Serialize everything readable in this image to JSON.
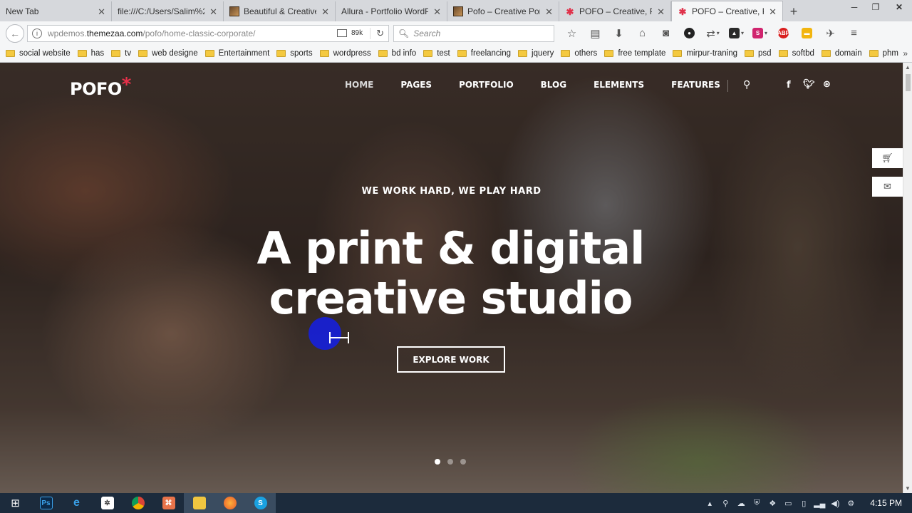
{
  "browser": {
    "tabs": [
      {
        "title": "New Tab",
        "favicon": "none",
        "active": false
      },
      {
        "title": "file:///C:/Users/Salim%2",
        "favicon": "none",
        "active": false
      },
      {
        "title": "Beautiful & Creative",
        "favicon": "theme-thumb-icon",
        "active": false
      },
      {
        "title": "Allura - Portfolio WordP",
        "favicon": "none",
        "active": false
      },
      {
        "title": "Pofo – Creative Port",
        "favicon": "theme-thumb-icon",
        "active": false
      },
      {
        "title": "POFO – Creative, Po",
        "favicon": "pofo-star-icon",
        "active": false
      },
      {
        "title": "POFO – Creative, Po",
        "favicon": "pofo-star-icon",
        "active": true
      }
    ],
    "close_glyph": "✕",
    "new_tab_glyph": "+",
    "window_controls": {
      "minimize": "─",
      "restore": "❐",
      "close": "✕"
    },
    "url": {
      "prefix": "wpdemos.",
      "domain": "themezaa.com",
      "path": "/pofo/home-classic-corporate/"
    },
    "page_size": "89k",
    "search_placeholder": "Search",
    "toolbar_icons": [
      "star-icon",
      "library-icon",
      "download-icon",
      "home-icon",
      "pocket-icon",
      "extension-dark-icon",
      "extension-arrows-icon",
      "extension-hat-icon",
      "extension-s-icon",
      "adblock-icon",
      "extension-yellow-icon",
      "extension-pin-icon",
      "menu-icon"
    ],
    "bookmarks": [
      "social website",
      "has",
      "tv",
      "web designe",
      "Entertainment",
      "sports",
      "wordpress",
      "bd info",
      "test",
      "freelancing",
      "jquery",
      "others",
      "free template",
      "mirpur-traning",
      "psd",
      "softbd",
      "domain",
      "phm"
    ]
  },
  "site": {
    "logo": "POFO",
    "logo_mark": "*",
    "logo_mark_color": "#e8304a",
    "nav": [
      "HOME",
      "PAGES",
      "PORTFOLIO",
      "BLOG",
      "ELEMENTS",
      "FEATURES"
    ],
    "active_nav": "HOME",
    "social_icons": [
      "facebook-icon",
      "twitter-icon",
      "dribbble-icon"
    ],
    "hero": {
      "kicker": "WE WORK HARD, WE PLAY HARD",
      "title_line1": "A print & digital",
      "title_line2": "creative studio",
      "cta": "EXPLORE WORK"
    },
    "slider_dots": 3,
    "active_dot": 1
  },
  "taskbar": {
    "apps": [
      "windows-start-icon",
      "photoshop-icon",
      "ie-icon",
      "generic-app-icon",
      "chrome-icon",
      "app-orange-icon",
      "file-explorer-icon",
      "firefox-icon",
      "skype-icon"
    ],
    "clock": "4:15 PM"
  }
}
